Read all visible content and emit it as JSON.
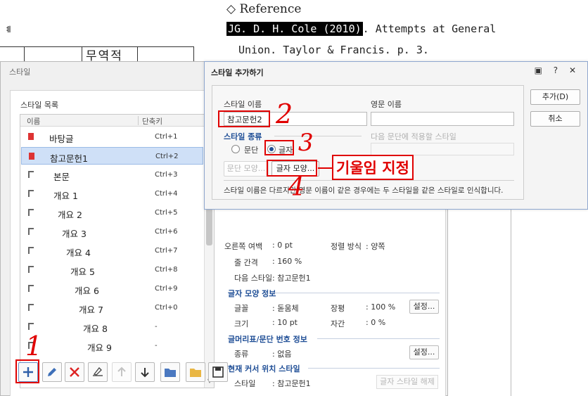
{
  "document": {
    "reference_heading": "◇ Reference",
    "ref_highlight": "JG. D. H. Cole (2010)",
    "ref_line1_rest": ". Attempts at General",
    "ref_line2": "Union. Taylor & Francis. p. 3.",
    "left_char": "ᅨ",
    "table_cell_text": "무역적"
  },
  "style_dialog": {
    "title": "스타일",
    "list_title": "스타일 목록",
    "col_name": "이름",
    "col_shortcut": "단축키",
    "items": [
      {
        "label": "바탕글",
        "key": "Ctrl+1",
        "type": "c"
      },
      {
        "label": "참고문헌1",
        "key": "Ctrl+2",
        "type": "c"
      },
      {
        "label": "본문",
        "key": "Ctrl+3",
        "type": "p"
      },
      {
        "label": "개요 1",
        "key": "Ctrl+4",
        "type": "p"
      },
      {
        "label": "개요 2",
        "key": "Ctrl+5",
        "type": "p"
      },
      {
        "label": "개요 3",
        "key": "Ctrl+6",
        "type": "p"
      },
      {
        "label": "개요 4",
        "key": "Ctrl+7",
        "type": "p"
      },
      {
        "label": "개요 5",
        "key": "Ctrl+8",
        "type": "p"
      },
      {
        "label": "개요 6",
        "key": "Ctrl+9",
        "type": "p"
      },
      {
        "label": "개요 7",
        "key": "Ctrl+0",
        "type": "p"
      },
      {
        "label": "개요 8",
        "key": "-",
        "type": "p"
      },
      {
        "label": "개요 9",
        "key": "-",
        "type": "p"
      }
    ],
    "selected_index": 1
  },
  "info": {
    "right_margin_label": "오른쪽 여백",
    "right_margin_value": ": 0 pt",
    "align_label": "정렬 방식",
    "align_value": ": 양쪽",
    "line_spacing_label": "줄 간격",
    "line_spacing_value": ": 160 %",
    "next_style_label": "다음 스타일",
    "next_style_value": ": 참고문헌1",
    "char_shape_heading": "글자 모양 정보",
    "font_label": "글꼴",
    "font_value": ": 돋움체",
    "ratio_label": "장평",
    "ratio_value": ": 100 %",
    "size_label": "크기",
    "size_value": ": 10 pt",
    "spacing_label": "자간",
    "spacing_value": ": 0 %",
    "set_button": "설정...",
    "bullet_heading": "글머리표/문단 번호 정보",
    "kind_label": "종류",
    "kind_value": ": 없음",
    "cursor_heading": "현재 커서 위치 스타일",
    "style_label": "스타일",
    "style_value": ": 참고문헌1",
    "unset_button": "글자 스타일 해제"
  },
  "add_dialog": {
    "title": "스타일 추가하기",
    "controls": "▣ ? ✕",
    "style_name_label": "스타일 이름",
    "style_name_value": "참고문헌2",
    "english_name_label": "영문 이름",
    "english_name_value": "",
    "style_type_label": "스타일 종류",
    "radio_paragraph": "문단",
    "radio_char": "글자",
    "next_para_label": "다음 문단에 적용할 스타일",
    "para_shape_button": "문단 모양...",
    "char_shape_button": "글자 모양...",
    "note": "스타일 이름은 다르지만 영문 이름이 같은 경우에는 두 스타일을 같은 스타일로 인식합니다.",
    "add_button": "추가(D)",
    "cancel_button": "취소"
  },
  "annotations": {
    "n1": "1",
    "n2": "2",
    "n3": "3",
    "n4": "4",
    "label": "기울임 지정",
    "color": "#e00000"
  }
}
